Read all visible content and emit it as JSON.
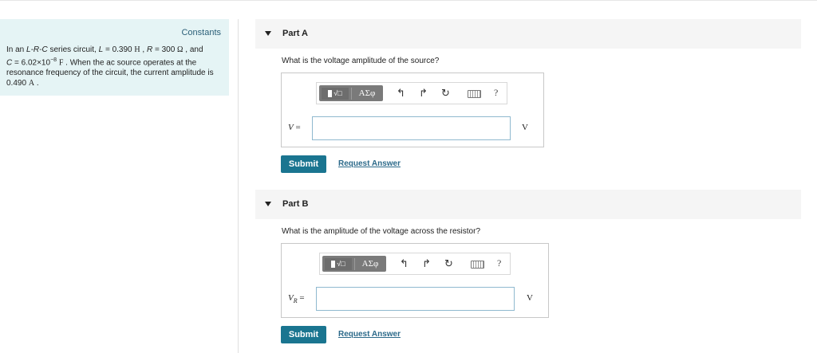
{
  "sidebar": {
    "constants_label": "Constants",
    "problem": {
      "t1": "In an ",
      "circuit_type": "L-R-C",
      "t2": " series circuit, ",
      "L_sym": "L",
      "L_val": " = 0.390 ",
      "L_unit": "H",
      "sep1": " , ",
      "R_sym": "R",
      "R_val": " = 300 ",
      "R_unit": "Ω",
      "t3": " , and",
      "C_sym": "C",
      "C_val": " = 6.02×10",
      "C_exp": "−8",
      "C_unit": "F",
      "t4": " . When the ac source operates at the resonance frequency of the circuit, the current amplitude is 0.490 ",
      "I_unit": "A",
      "t5": " ."
    }
  },
  "partA": {
    "title": "Part A",
    "question": "What is the voltage amplitude of the source?",
    "var_label": "V",
    "equals": " =",
    "input_value": "",
    "unit": "V",
    "submit_label": "Submit",
    "request_label": "Request Answer"
  },
  "partB": {
    "title": "Part B",
    "question": "What is the amplitude of the voltage across the resistor?",
    "var_label": "V",
    "var_sub": "R",
    "equals": " =",
    "input_value": "",
    "unit": "V",
    "submit_label": "Submit",
    "request_label": "Request Answer"
  },
  "toolbar": {
    "templates_label": "√□",
    "greek_label": "ΑΣφ",
    "undo_glyph": "↰",
    "redo_glyph": "↱",
    "reset_glyph": "↻",
    "help_glyph": "?"
  },
  "icons": {
    "collapse": "caret-down-icon",
    "undo": "undo-icon",
    "redo": "redo-icon",
    "reset": "reset-icon",
    "keyboard": "keyboard-icon",
    "help": "help-icon"
  },
  "colors": {
    "sidebar_bg": "#e5f4f5",
    "submit_bg": "#1a7590",
    "link": "#2c6a8a",
    "input_border": "#8fb9cf"
  }
}
